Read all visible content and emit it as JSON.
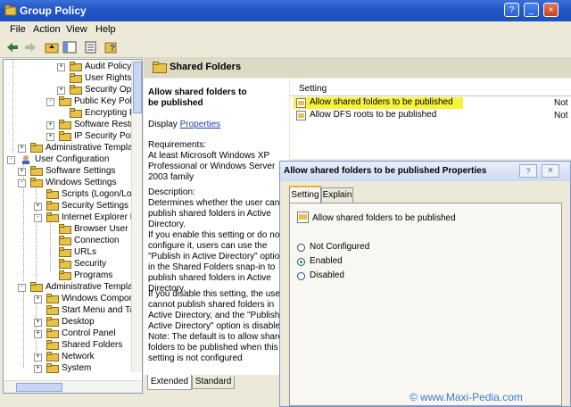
{
  "window": {
    "title": "Group Policy",
    "buttons": [
      "?",
      "_",
      "×"
    ]
  },
  "menu": [
    "File",
    "Action",
    "View",
    "Help"
  ],
  "toolbar": [
    "back-icon",
    "forward-icon",
    "up-folder-icon",
    "show-tree-icon",
    "export-list-icon",
    "help-icon"
  ],
  "tree": [
    {
      "label": "Audit Policy"
    },
    {
      "label": "User Rights"
    },
    {
      "label": "Security Opt"
    },
    {
      "label": "Public Key Polici"
    },
    {
      "label": "Encrypting F"
    },
    {
      "label": "Software Restri"
    },
    {
      "label": "IP Security Polic"
    },
    {
      "label": "Administrative Template"
    },
    {
      "label": "User Configuration"
    },
    {
      "label": "Software Settings"
    },
    {
      "label": "Windows Settings"
    },
    {
      "label": "Scripts (Logon/Logo"
    },
    {
      "label": "Security Settings"
    },
    {
      "label": "Internet Explorer Ma"
    },
    {
      "label": "Browser User In"
    },
    {
      "label": "Connection"
    },
    {
      "label": "URLs"
    },
    {
      "label": "Security"
    },
    {
      "label": "Programs"
    },
    {
      "label": "Administrative Template"
    },
    {
      "label": "Windows Compone"
    },
    {
      "label": "Start Menu and Tasl"
    },
    {
      "label": "Desktop"
    },
    {
      "label": "Control Panel"
    },
    {
      "label": "Shared Folders"
    },
    {
      "label": "Network"
    },
    {
      "label": "System"
    }
  ],
  "right_header": {
    "title": "Shared Folders"
  },
  "description": {
    "heading": "Allow shared folders to be published",
    "display_label": "Display",
    "properties_link": "Properties",
    "requirements": "Requirements:\nAt least Microsoft Windows XP Professional or Windows Server 2003 family",
    "desc_label": "Description:",
    "desc": "Determines whether the user can publish shared folders in Active Directory.",
    "para2": "If you enable this setting or do not configure it, users can use the \"Publish in Active Directory\" option in the Shared Folders snap-in to publish shared folders in Active Directory.",
    "para3": "If you disable this setting, the user cannot publish shared folders in Active Directory, and the \"Publish in Active Directory\" option is disabled. Note: The default is to allow shared folders to be published when this setting is not configured"
  },
  "bottom_tabs": [
    "Extended",
    "Standard"
  ],
  "list": {
    "header": "Setting",
    "rows": [
      {
        "setting": "Allow shared folders to be published",
        "state": "Not",
        "highlight": "#f7f23a"
      },
      {
        "setting": "Allow DFS roots to be published",
        "state": "Not"
      }
    ]
  },
  "dialog": {
    "title": "Allow shared folders to be published Properties",
    "buttons": [
      "?",
      "×"
    ],
    "tabs": [
      "Setting",
      "Explain"
    ],
    "policy_name": "Allow shared folders to be published",
    "options": [
      "Not Configured",
      "Enabled",
      "Disabled"
    ],
    "selected": "Enabled"
  },
  "watermark": "© www.Maxi-Pedia.com"
}
